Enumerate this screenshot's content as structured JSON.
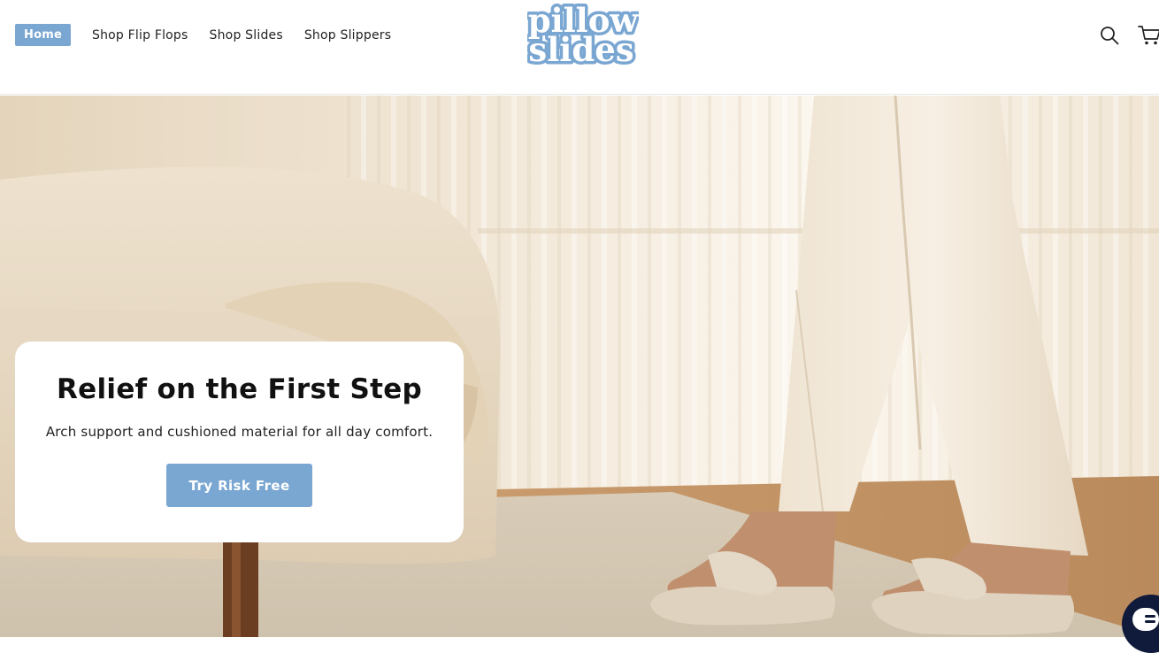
{
  "header": {
    "nav": [
      {
        "label": "Home",
        "active": true
      },
      {
        "label": "Shop Flip Flops",
        "active": false
      },
      {
        "label": "Shop Slides",
        "active": false
      },
      {
        "label": "Shop Slippers",
        "active": false
      }
    ],
    "logo": {
      "line1": "pillow",
      "line2": "slides"
    },
    "icons": [
      "search-icon",
      "cart-icon"
    ]
  },
  "hero": {
    "title": "Relief on the First Step",
    "subtitle": "Arch support and cushioned material for all day comfort.",
    "cta_label": "Try Risk Free"
  },
  "colors": {
    "accent": "#7aa6d2",
    "chat": "#101b3b"
  }
}
